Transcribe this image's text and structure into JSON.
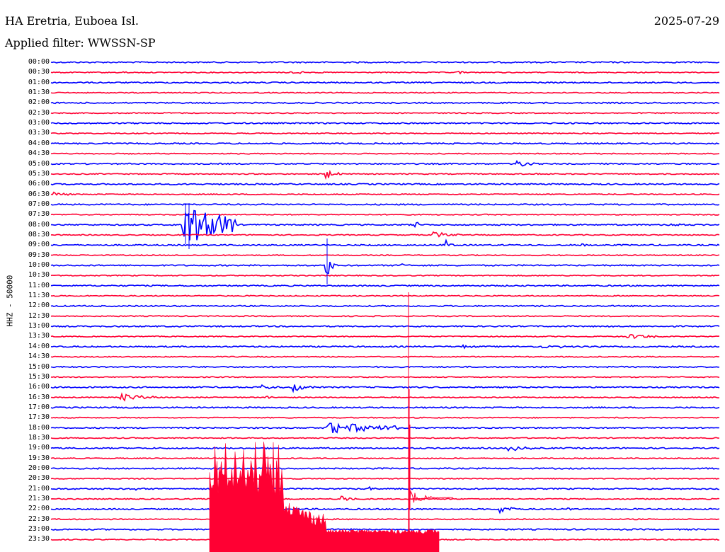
{
  "header": {
    "station": "HA Eretria, Euboea Isl.",
    "date": "2025-07-29",
    "filter": "Applied filter: WWSSN-SP"
  },
  "channel_label": "HHZ - 50000",
  "rows": [
    {
      "time": "00:00",
      "color": "#0000ff"
    },
    {
      "time": "00:30",
      "color": "#ff0033"
    },
    {
      "time": "01:00",
      "color": "#0000ff"
    },
    {
      "time": "01:30",
      "color": "#ff0033"
    },
    {
      "time": "02:00",
      "color": "#0000ff"
    },
    {
      "time": "02:30",
      "color": "#ff0033"
    },
    {
      "time": "03:00",
      "color": "#0000ff"
    },
    {
      "time": "03:30",
      "color": "#ff0033"
    },
    {
      "time": "04:00",
      "color": "#0000ff"
    },
    {
      "time": "04:30",
      "color": "#ff0033"
    },
    {
      "time": "05:00",
      "color": "#0000ff"
    },
    {
      "time": "05:30",
      "color": "#ff0033"
    },
    {
      "time": "06:00",
      "color": "#0000ff"
    },
    {
      "time": "06:30",
      "color": "#ff0033"
    },
    {
      "time": "07:00",
      "color": "#0000ff"
    },
    {
      "time": "07:30",
      "color": "#ff0033"
    },
    {
      "time": "08:00",
      "color": "#0000ff"
    },
    {
      "time": "08:30",
      "color": "#ff0033"
    },
    {
      "time": "09:00",
      "color": "#0000ff"
    },
    {
      "time": "09:30",
      "color": "#ff0033"
    },
    {
      "time": "10:00",
      "color": "#0000ff"
    },
    {
      "time": "10:30",
      "color": "#ff0033"
    },
    {
      "time": "11:00",
      "color": "#0000ff"
    },
    {
      "time": "11:30",
      "color": "#ff0033"
    },
    {
      "time": "12:00",
      "color": "#0000ff"
    },
    {
      "time": "12:30",
      "color": "#ff0033"
    },
    {
      "time": "13:00",
      "color": "#0000ff"
    },
    {
      "time": "13:30",
      "color": "#ff0033"
    },
    {
      "time": "14:00",
      "color": "#0000ff"
    },
    {
      "time": "14:30",
      "color": "#ff0033"
    },
    {
      "time": "15:00",
      "color": "#0000ff"
    },
    {
      "time": "15:30",
      "color": "#ff0033"
    },
    {
      "time": "16:00",
      "color": "#0000ff"
    },
    {
      "time": "16:30",
      "color": "#ff0033"
    },
    {
      "time": "17:00",
      "color": "#0000ff"
    },
    {
      "time": "17:30",
      "color": "#ff0033"
    },
    {
      "time": "18:00",
      "color": "#0000ff"
    },
    {
      "time": "18:30",
      "color": "#ff0033"
    },
    {
      "time": "19:00",
      "color": "#0000ff"
    },
    {
      "time": "19:30",
      "color": "#ff0033"
    },
    {
      "time": "20:00",
      "color": "#0000ff"
    },
    {
      "time": "20:30",
      "color": "#ff0033"
    },
    {
      "time": "21:00",
      "color": "#0000ff"
    },
    {
      "time": "21:30",
      "color": "#ff0033"
    },
    {
      "time": "22:00",
      "color": "#0000ff"
    },
    {
      "time": "22:30",
      "color": "#ff0033"
    },
    {
      "time": "23:00",
      "color": "#0000ff"
    },
    {
      "time": "23:30",
      "color": "#ff0033"
    }
  ],
  "colors": {
    "blue_trace": "#0000ff",
    "red_trace": "#ff0033",
    "text": "#000000",
    "background": "#ffffff"
  }
}
